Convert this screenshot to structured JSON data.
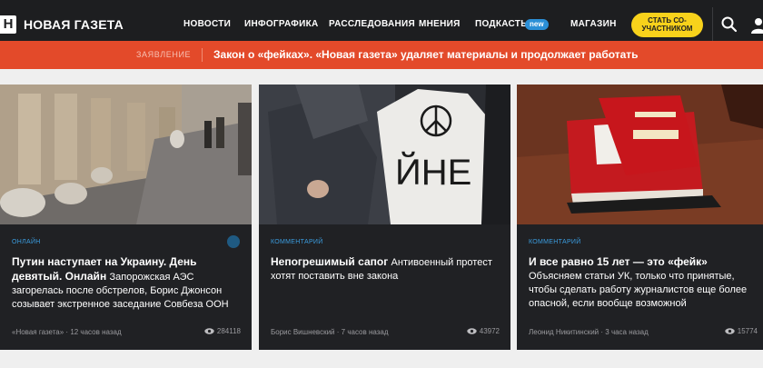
{
  "header": {
    "logo_mark": "Н",
    "logo_text": "НОВАЯ ГАЗЕТА",
    "nav": [
      "НОВОСТИ",
      "ИНФОГРАФИКА",
      "РАССЛЕДОВАНИЯ",
      "МНЕНИЯ",
      "ПОДКАСТЫ",
      "МАГАЗИН"
    ],
    "podcasts_badge": "new",
    "cta_line1": "СТАТЬ СО-",
    "cta_line2": "УЧАСТНИКОМ",
    "icons": [
      "search-icon",
      "user-icon"
    ]
  },
  "statement": {
    "label": "ЗАЯВЛЕНИЕ",
    "text": "Закон о «фейках». «Новая газета» удаляет материалы и продолжает работать"
  },
  "cards": [
    {
      "category": "ОНЛАЙН",
      "title": "Путин наступает на Украину. День девятый. Онлайн",
      "lead": "Запорожская АЭС загорелась после обстрелов, Борис Джонсон созывает экстренное заседание Совбеза ООН",
      "author": "«Новая газета»",
      "time": "12 часов назад",
      "views": "284118"
    },
    {
      "category": "КОММЕНТАРИЙ",
      "title": "Непогрешимый сапог",
      "lead": "Антивоенный протест хотят поставить вне закона",
      "author": "Борис Вишневский",
      "time": "7 часов назад",
      "views": "43972"
    },
    {
      "category": "КОММЕНТАРИЙ",
      "title": "И все равно 15 лет — это «фейк»",
      "lead": "Объясняем статьи УК, только что принятые, чтобы сделать работу журналистов еще более опасной, если вообще возможной",
      "author": "Леонид Никитинский",
      "time": "3 часа назад",
      "views": "15774"
    }
  ],
  "meta_separator": "·",
  "colors": {
    "topbar": "#1d1e20",
    "statement_bar": "#e34a2a",
    "cta": "#f8d21b",
    "category": "#3b9de0",
    "card_bg": "#202124"
  }
}
